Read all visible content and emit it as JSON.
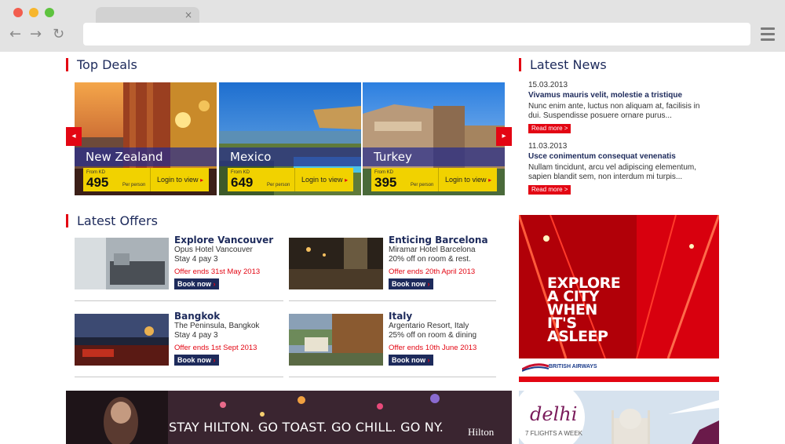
{
  "browser": {
    "tab_close": "×"
  },
  "sections": {
    "top_deals": "Top Deals",
    "latest_news": "Latest News",
    "latest_offers": "Latest Offers"
  },
  "deals": [
    {
      "name": "New Zealand",
      "from_label": "From KD",
      "price": "495",
      "per": "Per person",
      "login": "Login to view"
    },
    {
      "name": "Mexico",
      "from_label": "From KD",
      "price": "649",
      "per": "Per person",
      "login": "Login to view"
    },
    {
      "name": "Turkey",
      "from_label": "From KD",
      "price": "395",
      "per": "Per person",
      "login": "Login to view"
    }
  ],
  "news": [
    {
      "date": "15.03.2013",
      "title": "Vivamus mauris velit, molestie a tristique",
      "body_1": "Nunc enim ante, luctus non aliquam at, facilisis in",
      "body_2": "dui. Suspendisse posuere ornare purus...",
      "read_more": "Read more >"
    },
    {
      "date": "11.03.2013",
      "title": "Usce conimentum consequat venenatis",
      "body_1": "Nullam tincidunt, arcu vel adipiscing elementum,",
      "body_2": "sapien blandit sem, non interdum mi turpis...",
      "read_more": "Read more >"
    }
  ],
  "offers": [
    {
      "title": "Explore Vancouver",
      "line1": "Opus Hotel Vancouver",
      "line2": "Stay 4 pay 3",
      "ends": "Offer ends 31st May 2013",
      "book": "Book now"
    },
    {
      "title": "Enticing Barcelona",
      "line1": "Miramar Hotel Barcelona",
      "line2": "20% off on room & rest.",
      "ends": "Offer ends 20th April 2013",
      "book": "Book now"
    },
    {
      "title": "Bangkok",
      "line1": "The Peninsula, Bangkok",
      "line2": "Stay 4 pay 3",
      "ends": "Offer ends 1st Sept 2013",
      "book": "Book now"
    },
    {
      "title": "Italy",
      "line1": "Argentario Resort, Italy",
      "line2": "25% off on room & dining",
      "ends": "Offer ends 10th June 2013",
      "book": "Book now"
    }
  ],
  "ads": {
    "city": {
      "l1": "EXPLORE",
      "l2": "A CITY",
      "l3": "WHEN",
      "l4": "IT'S",
      "l5": "ASLEEP",
      "brand": "BRITISH AIRWAYS"
    },
    "hilton": {
      "text": "STAY HILTON. GO TOAST. GO CHILL. GO NY.",
      "logo": "Hilton"
    },
    "delhi": {
      "title": "delhi",
      "sub": "7 FLIGHTS A WEEK"
    }
  },
  "colors": {
    "accent": "#e30613",
    "navy": "#1d2a5b",
    "deal_yellow": "#f1d200"
  }
}
